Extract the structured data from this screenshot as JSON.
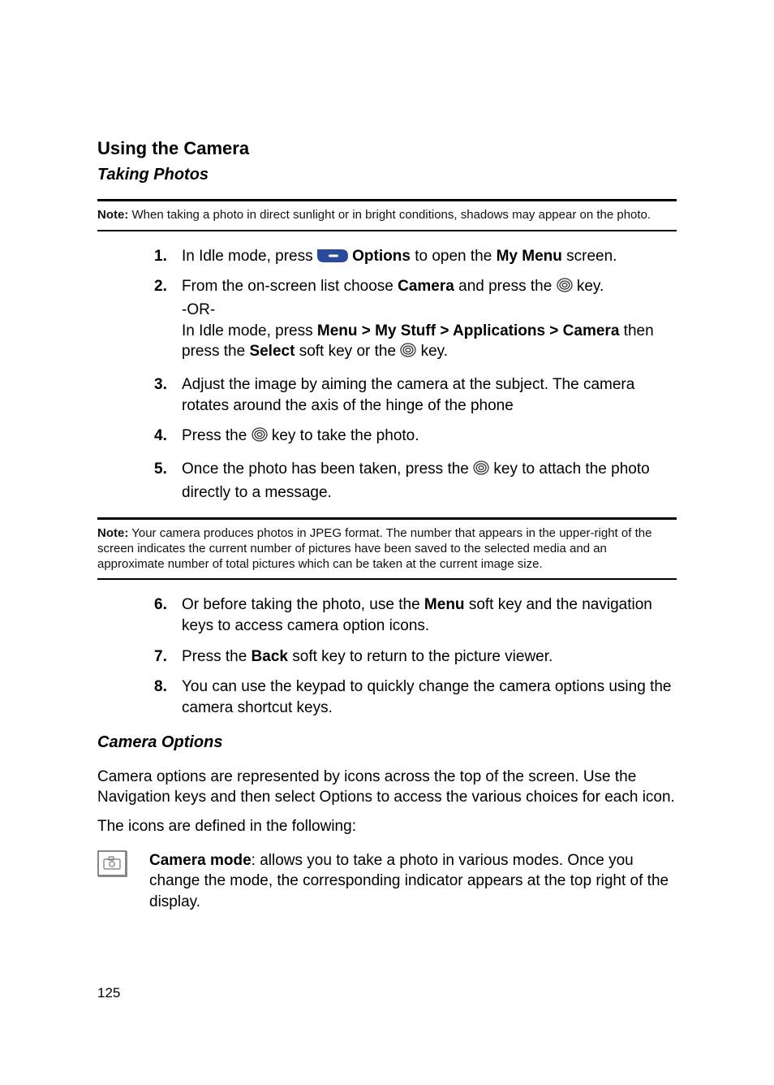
{
  "headings": {
    "main": "Using the Camera",
    "sub1": "Taking Photos",
    "sub2": "Camera Options"
  },
  "notes": {
    "note1_label": "Note:",
    "note1_text": " When taking a photo in direct sunlight or in bright conditions, shadows may appear on the photo.",
    "note2_label": "Note:",
    "note2_text": " Your camera produces photos in JPEG format. The number that appears in the upper-right of the screen indicates the current number of pictures have been saved to the selected media and an approximate number of total pictures which can be taken at the current image size."
  },
  "steps_a": [
    {
      "n": "1.",
      "pre": "In Idle mode, press ",
      "bold1": "Options",
      "mid": " to open the ",
      "bold2": "My Menu",
      "post": " screen."
    },
    {
      "n": "2.",
      "pre": "From the on-screen list choose ",
      "bold1": "Camera",
      "mid": " and press the ",
      "post": " key.",
      "sub_or": "-OR-",
      "sub2_pre": "In Idle mode, press ",
      "sub2_bold": "Menu > My Stuff > Applications > Camera",
      "sub2_mid": " then press the ",
      "sub2_bold2": "Select",
      "sub2_post": " soft key or the ",
      "sub2_end": " key."
    },
    {
      "n": "3.",
      "text": "Adjust the image by aiming the camera at the subject. The camera rotates around the axis of the hinge of the phone"
    },
    {
      "n": "4.",
      "pre": "Press the ",
      "post": " key to take the photo."
    },
    {
      "n": "5.",
      "pre": "Once the photo has been taken, press the ",
      "post": " key to attach the photo directly to a message."
    }
  ],
  "steps_b": [
    {
      "n": "6.",
      "pre": "Or before taking the photo, use the ",
      "bold1": "Menu",
      "post": " soft key and the navigation keys to access camera option icons."
    },
    {
      "n": "7.",
      "pre": "Press the ",
      "bold1": "Back",
      "post": " soft key to return to the picture viewer."
    },
    {
      "n": "8.",
      "text": "You can use the keypad to quickly change the camera options using the camera shortcut keys."
    }
  ],
  "camera_options": {
    "intro1": "Camera options are represented by icons across the top of the screen. Use the Navigation keys and then select Options to access the various choices for each icon.",
    "intro2": "The icons are defined in the following:",
    "mode_label": "Camera mode",
    "mode_text": ":  allows you to take a photo in various modes. Once you change the mode, the corresponding indicator appears at the top right of the display."
  },
  "page_number": "125"
}
